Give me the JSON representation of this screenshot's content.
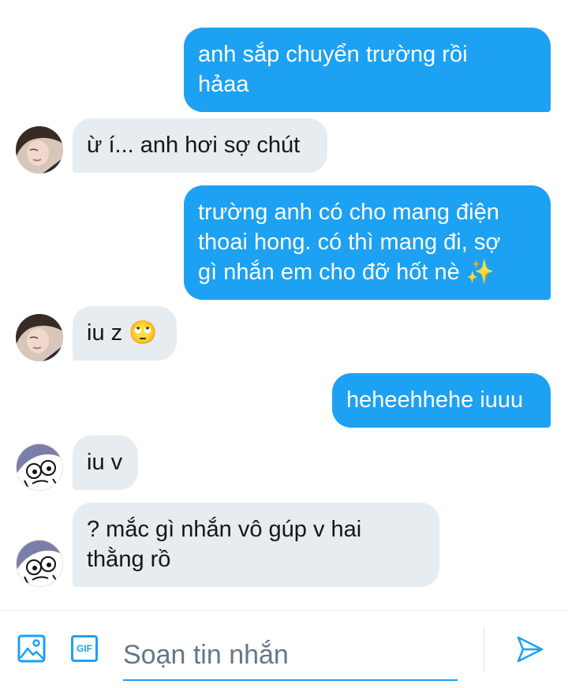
{
  "messages": [
    {
      "side": "out",
      "text": "anh sắp chuyển trường rồi\nhảaa"
    },
    {
      "side": "in",
      "avatar": "girl-avatar",
      "text": "ừ í... anh hơi sợ chút"
    },
    {
      "side": "out",
      "text": "trường anh có cho mang điện\nthoai hong. có thì mang đi, sợ\ngì nhắn em cho đỡ hốt nè ✨"
    },
    {
      "side": "in",
      "avatar": "girl-avatar",
      "text": "iu z 🙄"
    },
    {
      "side": "out",
      "text": "heheehhehe iuuu"
    },
    {
      "side": "in",
      "avatar": "doodle-avatar",
      "text": "iu v"
    },
    {
      "side": "in",
      "avatar": "doodle-avatar",
      "text": "? mắc gì nhắn vô gúp v hai\nthằng rồ"
    }
  ],
  "composer": {
    "placeholder": "Soạn tin nhắn",
    "gif_label": "GIF",
    "icons": [
      "image-icon",
      "gif-icon",
      "send-icon"
    ]
  },
  "colors": {
    "accent": "#1da1f2",
    "incoming_bubble": "#e6ecf0"
  }
}
